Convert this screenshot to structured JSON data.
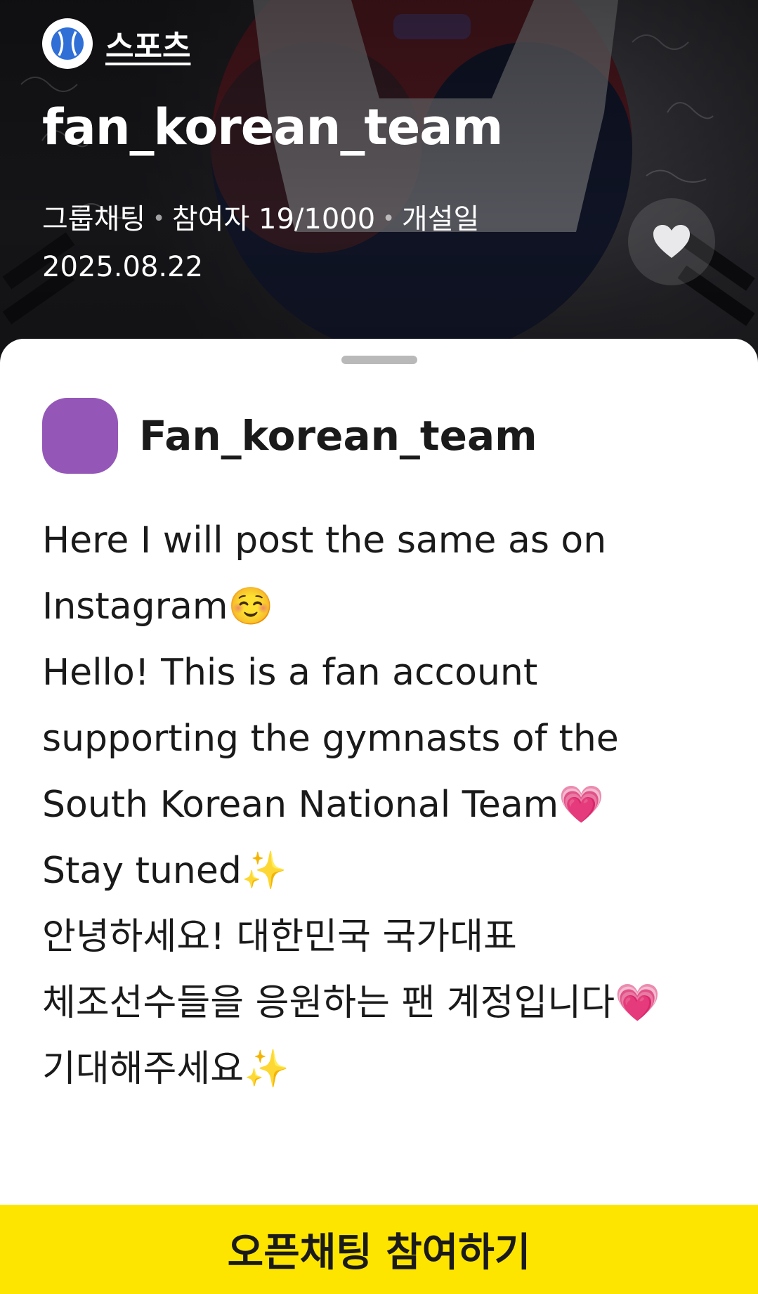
{
  "header": {
    "category_icon": "baseball-icon",
    "category_label": "스포츠",
    "room_title": "fan_korean_team",
    "meta": {
      "type": "그룹채팅",
      "participants": "참여자 19/1000",
      "opened_label": "개설일",
      "opened_date": "2025.08.22"
    },
    "like_icon": "heart-icon"
  },
  "profile": {
    "name": "Fan_korean_team",
    "avatar_color": "#9457b8"
  },
  "description": {
    "lines": [
      "Here I will post the same as on",
      "Instagram☺️",
      "Hello! This is a fan account",
      "supporting the gymnasts of the",
      "South Korean National Team💗",
      "Stay tuned✨",
      "안녕하세요! 대한민국 국가대표",
      "체조선수들을 응원하는 팬 계정입니다💗",
      "기대해주세요✨"
    ]
  },
  "footer": {
    "join_label": "오픈채팅 참여하기",
    "button_color": "#fee500"
  }
}
